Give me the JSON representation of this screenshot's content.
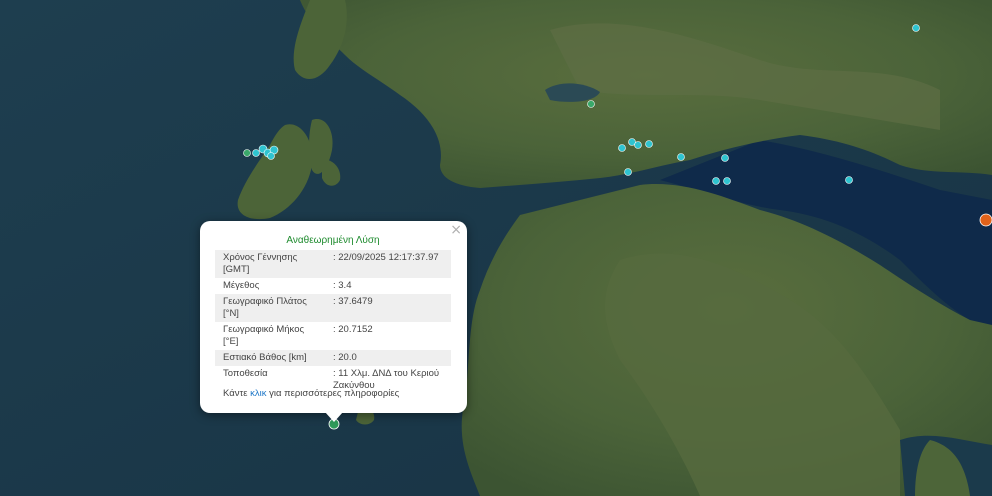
{
  "popup": {
    "heading": "Αναθεωρημένη Λύση",
    "close_icon": "×",
    "rows": [
      {
        "label": "Χρόνος Γέννησης [GMT]",
        "value": ": 22/09/2025 12:17:37.97"
      },
      {
        "label": "Μέγεθος",
        "value": ": 3.4"
      },
      {
        "label": "Γεωγραφικό Πλάτος [°N]",
        "value": ": 37.6479"
      },
      {
        "label": "Γεωγραφικό Μήκος [°E]",
        "value": ": 20.7152"
      },
      {
        "label": "Εστιακό Βάθος [km]",
        "value": ": 20.0"
      },
      {
        "label": "Τοποθεσία",
        "value": ": 11 Χλμ. ΔΝΔ του Κεριού Ζακύνθου"
      }
    ],
    "more_prefix": "Κάντε",
    "more_link": "κλικ",
    "more_suffix": "για περισσότερες πληροφορίες"
  },
  "map": {
    "base": "satellite-imagery",
    "colors": {
      "sea": "#1b3a4b",
      "land": "#4f6a3e",
      "recent_event": "#2fc4d0",
      "selected_event": "#2f9a5a",
      "older_event": "#3aa86a",
      "large_event": "#e0621a"
    }
  }
}
